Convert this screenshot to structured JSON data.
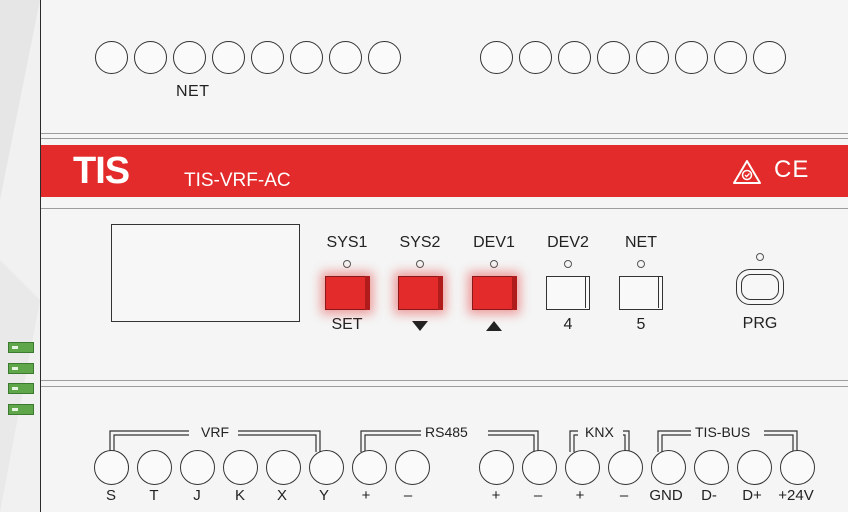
{
  "brand": {
    "logo": "TIS",
    "model": "TIS-VRF-AC",
    "accent": "#e32b2b",
    "led_glow": "#e32b2b"
  },
  "top": {
    "net_label": "NET"
  },
  "certifications": [
    "warning-triangle-icon",
    "CE"
  ],
  "ce_text": "CE",
  "buttons": [
    {
      "top": "SYS1",
      "bottom": "SET",
      "state": "red"
    },
    {
      "top": "SYS2",
      "bottom": "▼",
      "state": "red"
    },
    {
      "top": "DEV1",
      "bottom": "▲",
      "state": "red"
    },
    {
      "top": "DEV2",
      "bottom": "4",
      "state": "white"
    },
    {
      "top": "NET",
      "bottom": "5",
      "state": "white"
    }
  ],
  "prg": {
    "label": "PRG"
  },
  "groups": {
    "vrf": "VRF",
    "rs485": "RS485",
    "knx": "KNX",
    "tisbus": "TIS-BUS"
  },
  "pins": [
    "S",
    "T",
    "J",
    "K",
    "X",
    "Y",
    "+",
    "–",
    "+",
    "–",
    "+",
    "–",
    "GND",
    "D-",
    "D+",
    "+24V"
  ]
}
